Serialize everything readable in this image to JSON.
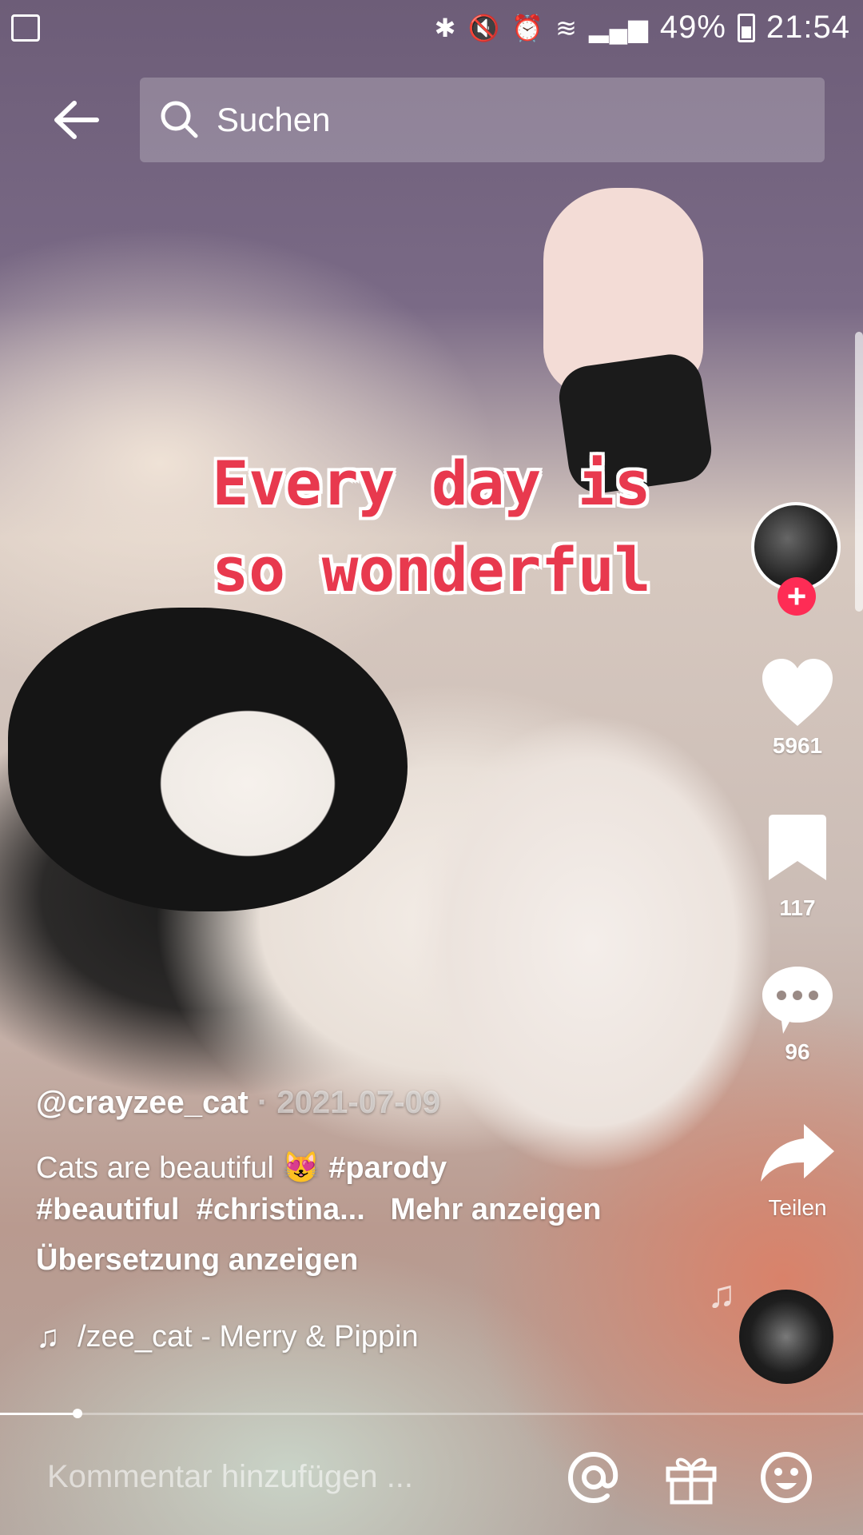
{
  "status_bar": {
    "battery_percent": "49%",
    "time": "21:54"
  },
  "search": {
    "placeholder": "Suchen"
  },
  "video_overlay": {
    "line1": "Every day is",
    "line2": "so wonderful"
  },
  "actions": {
    "likes": "5961",
    "saves": "117",
    "comments": "96",
    "share_label": "Teilen"
  },
  "post": {
    "username": "@crayzee_cat",
    "separator": " · ",
    "date": "2021-07-09",
    "caption_text": "Cats are beautiful",
    "emoji": "😻",
    "hashtags": [
      "#parody",
      "#beautiful",
      "#christina..."
    ],
    "more_label": "Mehr anzeigen",
    "translate_label": "Übersetzung anzeigen",
    "sound": "/zee_cat - Merry & Pippin"
  },
  "comment_bar": {
    "placeholder": "Kommentar hinzufügen ..."
  },
  "playback": {
    "progress_fraction": 0.09
  },
  "colors": {
    "overlay_text": "#e8394e",
    "follow_badge": "#fe2c55"
  }
}
